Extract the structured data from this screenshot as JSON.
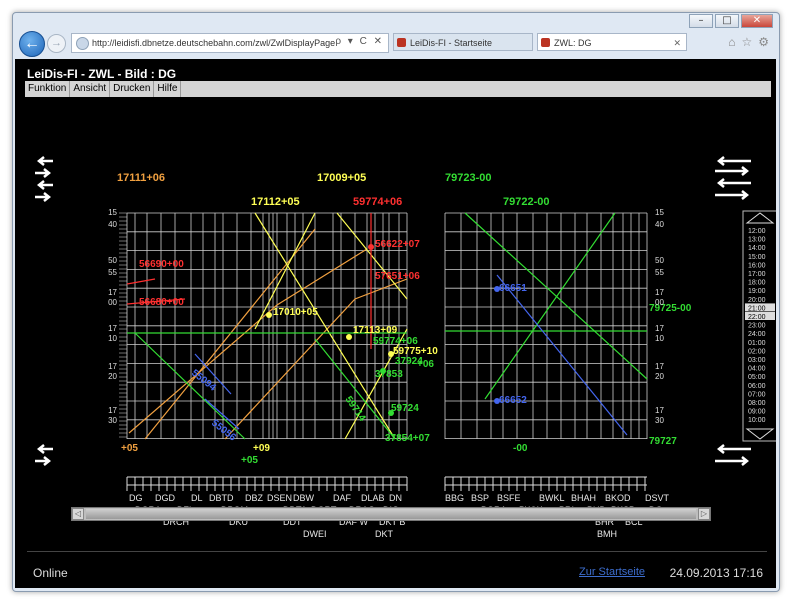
{
  "browser": {
    "url": "http://leidisfi.dbnetze.deutschebahn.com/zwl/ZwlDisplayPage",
    "url_controls": "ρ ▾ C ✕",
    "tabs": [
      {
        "label": "LeiDis-FI - Startseite"
      },
      {
        "label": "ZWL: DG"
      }
    ],
    "close_tab": "✕"
  },
  "app": {
    "title": "LeiDis-FI - ZWL - Bild : DG",
    "menu": [
      "Funktion",
      "Ansicht",
      "Drucken",
      "Hilfe"
    ]
  },
  "graph": {
    "top_labels": [
      {
        "text": "17111+06",
        "color": "#f0a040"
      },
      {
        "text": "17009+05",
        "color": "#ffff55"
      },
      {
        "text": "17112+05",
        "color": "#ffff55"
      },
      {
        "text": "59774+06",
        "color": "#ff3030"
      },
      {
        "text": "79723-00",
        "color": "#33dd33"
      },
      {
        "text": "79722-00",
        "color": "#33dd33"
      }
    ],
    "train_labels": [
      {
        "text": "56690+00",
        "color": "#ff3030"
      },
      {
        "text": "56680+00",
        "color": "#ff3030"
      },
      {
        "text": "56622+07",
        "color": "#ff3030"
      },
      {
        "text": "57651+06",
        "color": "#ff3030"
      },
      {
        "text": "17010+05",
        "color": "#ffff55"
      },
      {
        "text": "17113+09",
        "color": "#ffff55"
      },
      {
        "text": "59775+10",
        "color": "#ffff55"
      },
      {
        "text": "59774+06",
        "color": "#33dd33"
      },
      {
        "text": "55094",
        "color": "#4466ee"
      },
      {
        "text": "55056",
        "color": "#4466ee"
      },
      {
        "text": "59714",
        "color": "#33dd33"
      },
      {
        "text": "37853",
        "color": "#33dd33"
      },
      {
        "text": "37924",
        "color": "#33dd33"
      },
      {
        "text": "+06",
        "color": "#33dd33"
      },
      {
        "text": "59724",
        "color": "#33dd33"
      },
      {
        "text": "37854+07",
        "color": "#33dd33"
      },
      {
        "text": "66651",
        "color": "#4466ee"
      },
      {
        "text": "66652",
        "color": "#4466ee"
      },
      {
        "text": "79725-00",
        "color": "#33dd33"
      },
      {
        "text": "79727",
        "color": "#33dd33"
      }
    ],
    "bottom_labels": [
      {
        "text": "+05",
        "color": "#f0a040"
      },
      {
        "text": "+09",
        "color": "#ffff55"
      },
      {
        "text": "+05",
        "color": "#33dd33"
      },
      {
        "text": "-00",
        "color": "#33dd33"
      }
    ],
    "time_labels": [
      "15",
      "40",
      "50",
      "55",
      "17",
      "00",
      "17",
      "10",
      "17",
      "20",
      "17",
      "30"
    ],
    "stations_left_row1": [
      "DG",
      "DGD",
      "DL",
      "DBTD",
      "DBZ",
      "DSEN",
      "DBW",
      "DAF",
      "DLAB",
      "DN"
    ],
    "stations_left_row2": [
      "DGRA",
      "DZL",
      "DPOM",
      "DDTA",
      "DGRT",
      "DRAG",
      "DIG"
    ],
    "stations_left_row3": [
      "DRCH",
      "DKU",
      "DDT",
      "DAF W",
      "DKT B"
    ],
    "stations_left_row4": [
      "DWEI",
      "DKT"
    ],
    "stations_right_row1": [
      "BBG",
      "BSP",
      "BSFE",
      "BWKL",
      "BHAH",
      "BKOD",
      "DSVT"
    ],
    "stations_right_row2": [
      "BGRA",
      "BWW",
      "BRI",
      "BUD",
      "BKSB",
      "DG"
    ],
    "stations_right_row3": [
      "BHR",
      "BCL"
    ],
    "stations_right_row4": [
      "BMH"
    ],
    "side_times": [
      "12:00",
      "13:00",
      "14:00",
      "15:00",
      "16:00",
      "17:00",
      "18:00",
      "19:00",
      "20:00",
      "21:00",
      "22:00",
      "23:00",
      "24:00",
      "01:00",
      "02:00",
      "03:00",
      "04:00",
      "05:00",
      "06:00",
      "07:00",
      "08:00",
      "09:00",
      "10:00"
    ]
  },
  "status": {
    "state": "Online",
    "home_link": "Zur Startseite",
    "datetime": "24.09.2013 17:16"
  },
  "colors": {
    "orange": "#f0a040",
    "yellow": "#ffff55",
    "red": "#ff3030",
    "green": "#33dd33",
    "blue": "#4466ee",
    "grid": "#cfcfcf"
  }
}
